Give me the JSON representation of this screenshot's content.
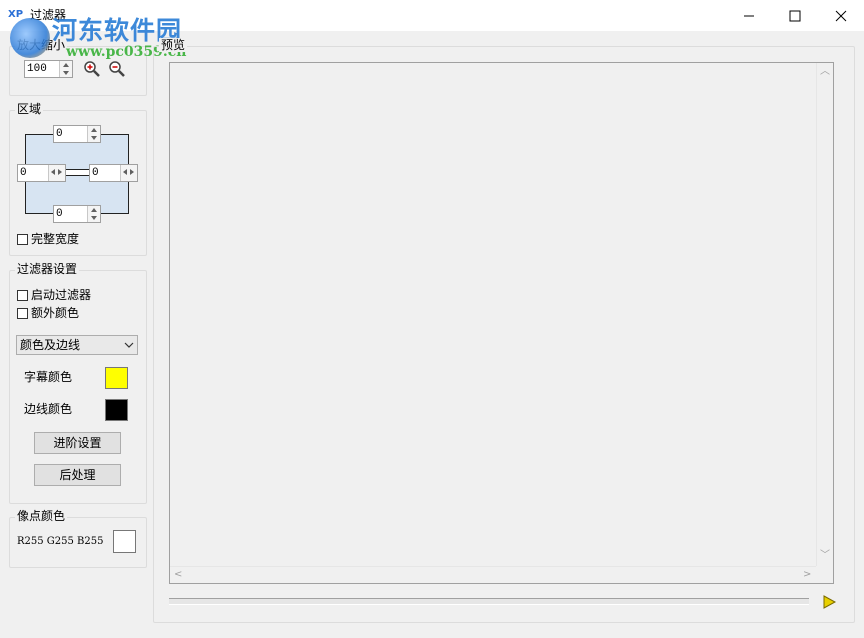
{
  "window": {
    "title": "过滤器",
    "icon_text": "XP",
    "watermark_title": "河东软件园",
    "watermark_url": "www.pc0359.cn"
  },
  "zoom": {
    "label": "放大缩小",
    "value": "100",
    "zoom_in_icon": "zoom-in-icon",
    "zoom_out_icon": "zoom-out-icon"
  },
  "region": {
    "label": "区域",
    "top": "0",
    "left": "0",
    "right": "0",
    "bottom": "0",
    "full_width_label": "完整宽度",
    "full_width_checked": false,
    "fill_color": "#d7e4f2"
  },
  "filter_settings": {
    "label": "过滤器设置",
    "enable_label": "启动过滤器",
    "enable_checked": false,
    "extra_color_label": "额外颜色",
    "extra_color_checked": false,
    "mode_selected": "颜色及边线",
    "subtitle_color_label": "字幕颜色",
    "subtitle_color": "#ffff00",
    "border_color_label": "边线颜色",
    "border_color": "#000000",
    "advanced_button": "进阶设置",
    "post_process_button": "后处理"
  },
  "pixel_color": {
    "label": "像点颜色",
    "value_text": "R255 G255 B255",
    "swatch_color": "#ffffff"
  },
  "preview": {
    "label": "预览",
    "play_icon": "play-icon",
    "play_color": "#e8d000"
  }
}
